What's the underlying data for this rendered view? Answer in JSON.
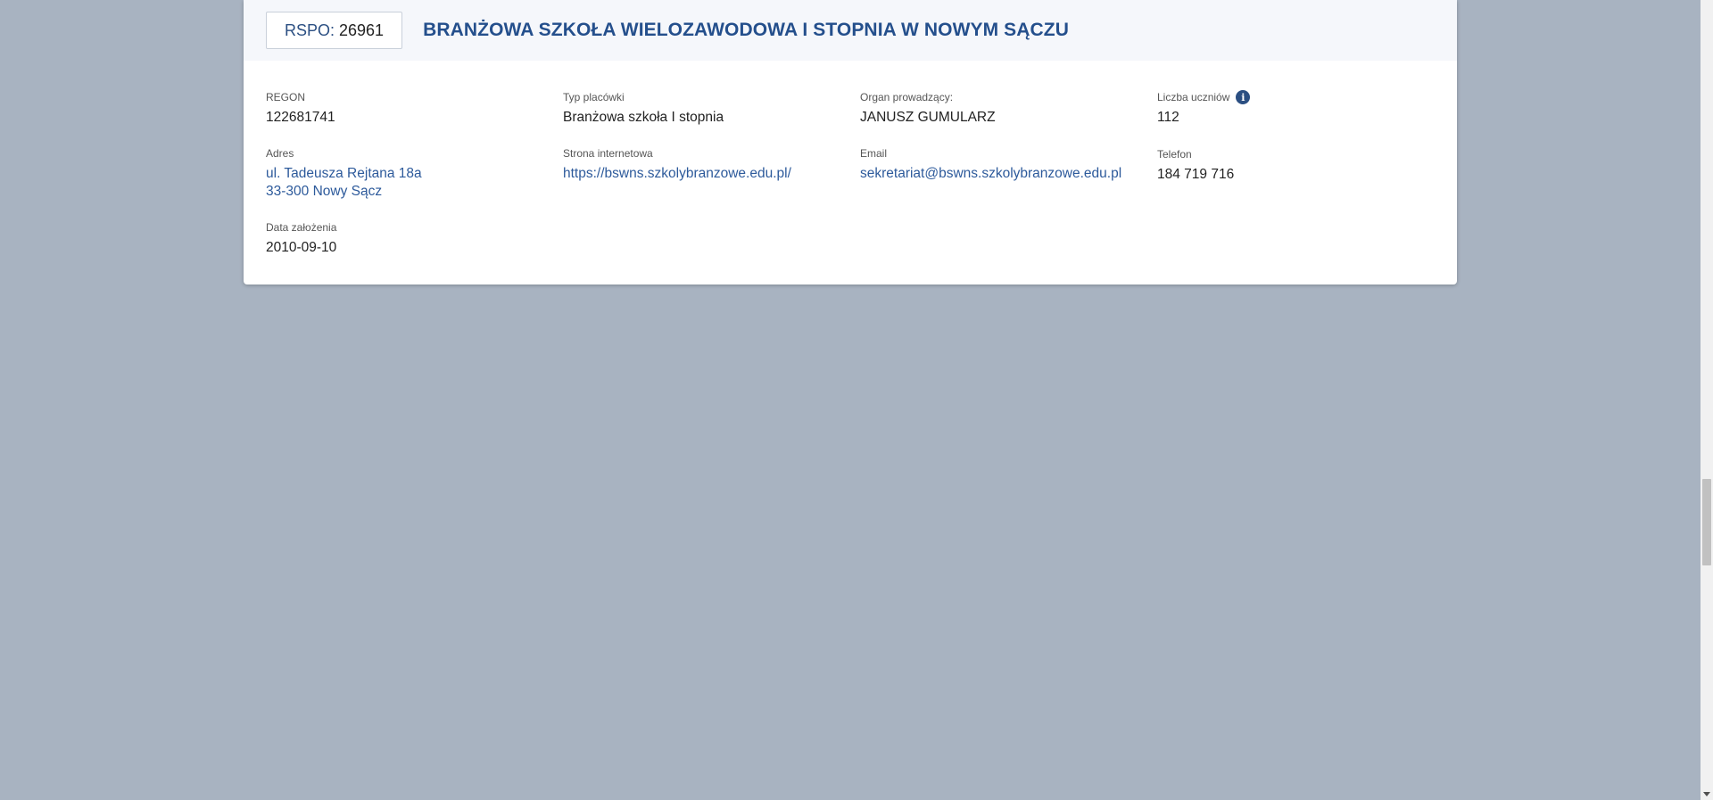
{
  "header": {
    "rspo_label": "RSPO:",
    "rspo_value": "26961",
    "school_name": "BRANŻOWA SZKOŁA WIELOZAWODOWA I STOPNIA W NOWYM SĄCZU"
  },
  "fields": {
    "regon": {
      "label": "REGON",
      "value": "122681741"
    },
    "typ": {
      "label": "Typ placówki",
      "value": "Branżowa szkoła I stopnia"
    },
    "organ": {
      "label": "Organ prowadzący:",
      "value": "JANUSZ GUMULARZ"
    },
    "liczba": {
      "label": "Liczba uczniów",
      "value": "112",
      "icon": "info-icon"
    },
    "adres": {
      "label": "Adres",
      "line1": "ul. Tadeusza Rejtana 18a",
      "line2": "33-300 Nowy Sącz"
    },
    "strona": {
      "label": "Strona internetowa",
      "value": "https://bswns.szkolybranzowe.edu.pl/"
    },
    "email": {
      "label": "Email",
      "value": "sekretariat@bswns.szkolybranzowe.edu.pl"
    },
    "telefon": {
      "label": "Telefon",
      "value": "184 719 716"
    },
    "data": {
      "label": "Data założenia",
      "value": "2010-09-10"
    }
  },
  "colors": {
    "background": "#a8b3c1",
    "accent": "#244f8c",
    "link": "#2d5a9b"
  }
}
